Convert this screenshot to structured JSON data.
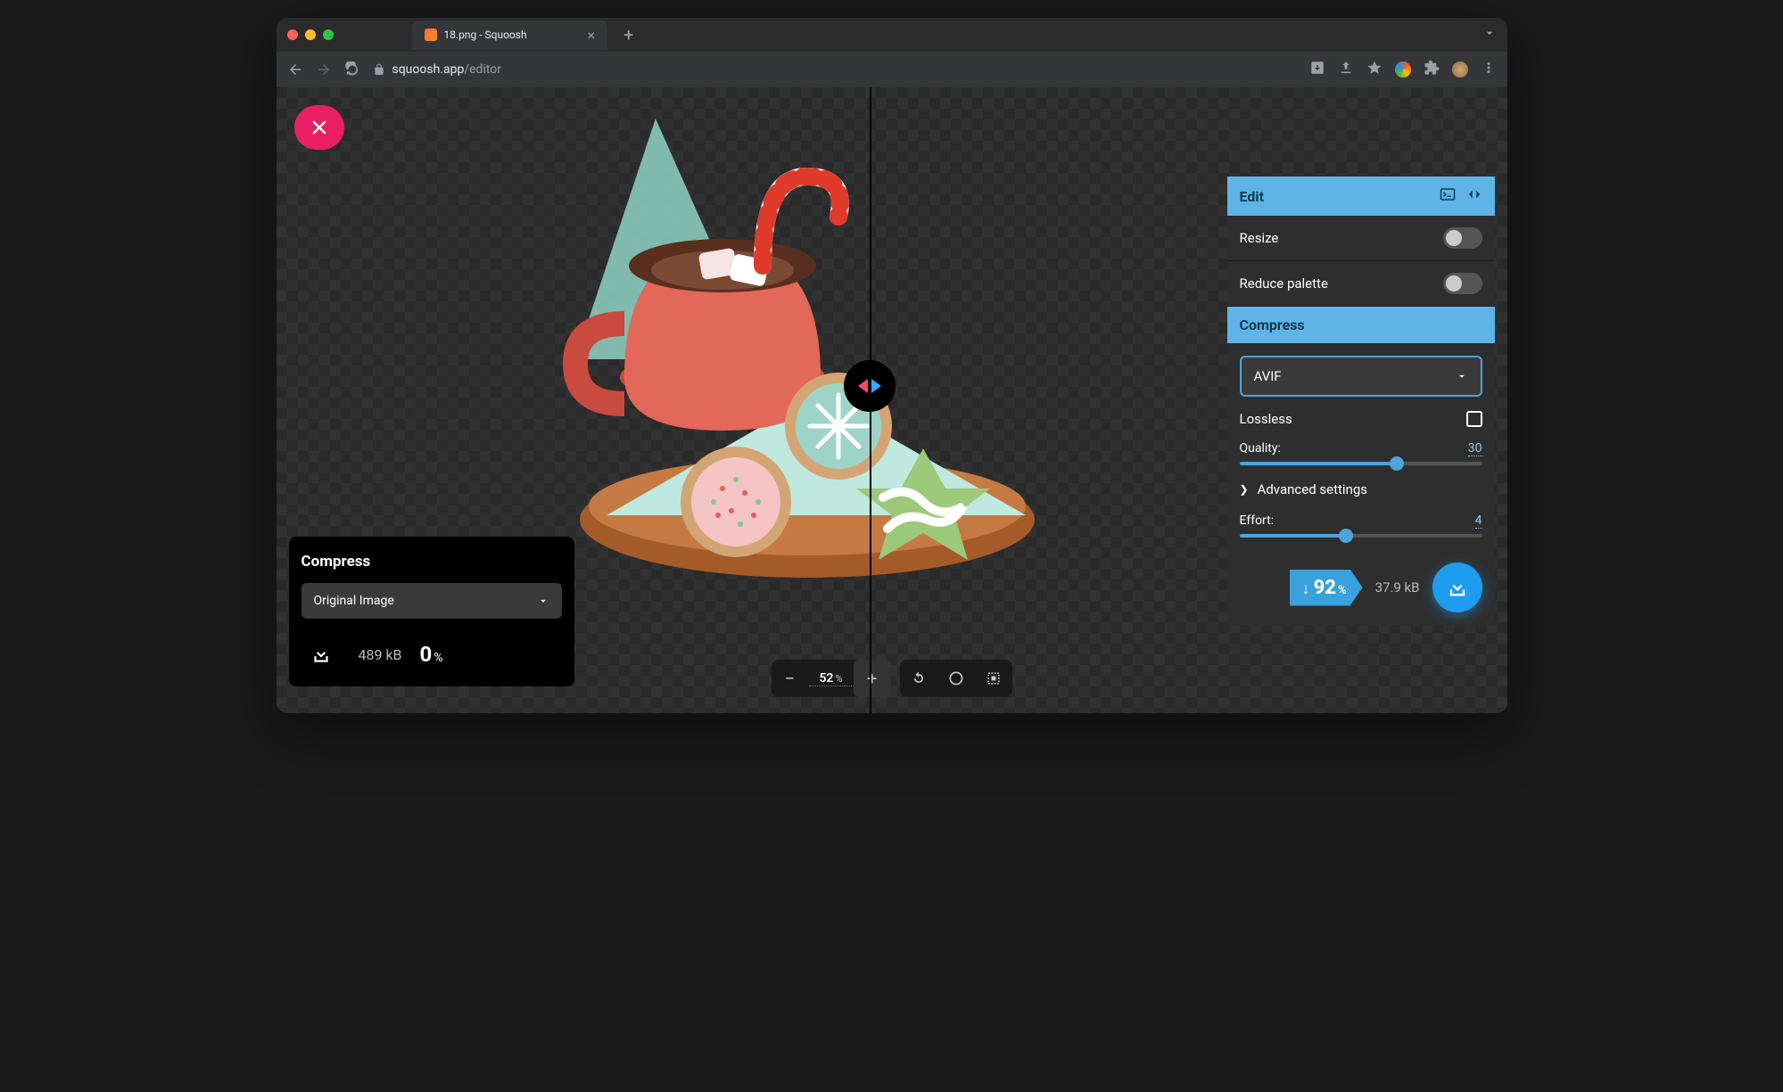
{
  "browser": {
    "tab_title": "18.png - Squoosh",
    "url_host": "squoosh.app",
    "url_path": "/editor"
  },
  "left": {
    "header": "Compress",
    "select_value": "Original Image",
    "filesize": "489 kB",
    "percent": "0",
    "percent_unit": "%"
  },
  "right": {
    "edit_header": "Edit",
    "resize_label": "Resize",
    "reduce_palette_label": "Reduce palette",
    "compress_header": "Compress",
    "codec": "AVIF",
    "lossless_label": "Lossless",
    "quality_label": "Quality:",
    "quality_value": "30",
    "advanced_label": "Advanced settings",
    "effort_label": "Effort:",
    "effort_value": "4",
    "savings_percent": "92",
    "savings_unit": "%",
    "filesize": "37.9 kB"
  },
  "zoom": {
    "value": "52",
    "unit": "%"
  },
  "sliders": {
    "quality_pct": 30,
    "effort_pct": 44
  }
}
